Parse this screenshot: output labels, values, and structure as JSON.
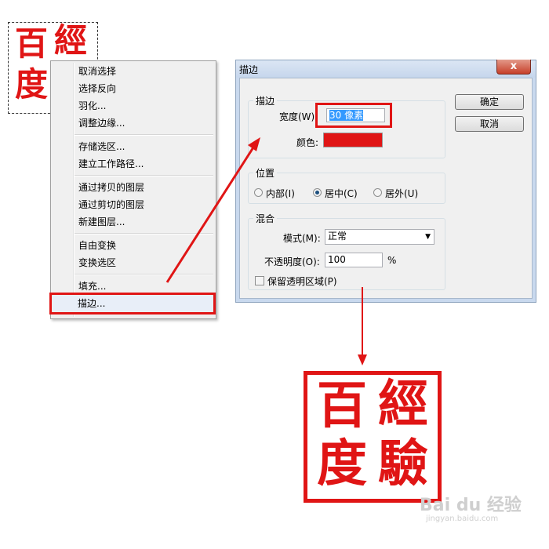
{
  "seal": {
    "chars": [
      "百",
      "經",
      "度",
      "驗"
    ]
  },
  "context_menu": {
    "items": [
      {
        "label": "取消选择"
      },
      {
        "label": "选择反向"
      },
      {
        "label": "羽化..."
      },
      {
        "label": "调整边缘..."
      },
      {
        "label": "存储选区..."
      },
      {
        "label": "建立工作路径..."
      },
      {
        "label": "通过拷贝的图层"
      },
      {
        "label": "通过剪切的图层"
      },
      {
        "label": "新建图层..."
      },
      {
        "label": "自由变换"
      },
      {
        "label": "变换选区"
      },
      {
        "label": "填充..."
      },
      {
        "label": "描边..."
      }
    ],
    "highlighted": "描边..."
  },
  "dialog": {
    "title": "描边",
    "close": "x",
    "ok_label": "确定",
    "cancel_label": "取消",
    "stroke_group": {
      "legend": "描边",
      "width_label": "宽度(W):",
      "width_value": "30 像素",
      "color_label": "颜色:",
      "color_value": "#e01515"
    },
    "position_group": {
      "legend": "位置",
      "options": [
        {
          "label": "内部(I)",
          "selected": false
        },
        {
          "label": "居中(C)",
          "selected": true
        },
        {
          "label": "居外(U)",
          "selected": false
        }
      ]
    },
    "blend_group": {
      "legend": "混合",
      "mode_label": "模式(M):",
      "mode_value": "正常",
      "opacity_label": "不透明度(O):",
      "opacity_value": "100",
      "opacity_unit": "%",
      "preserve_label": "保留透明区域(P)",
      "preserve_checked": false
    }
  },
  "accent_color": "#e01515",
  "watermark": {
    "brand": "Bai du 经验",
    "url": "jingyan.baidu.com"
  }
}
